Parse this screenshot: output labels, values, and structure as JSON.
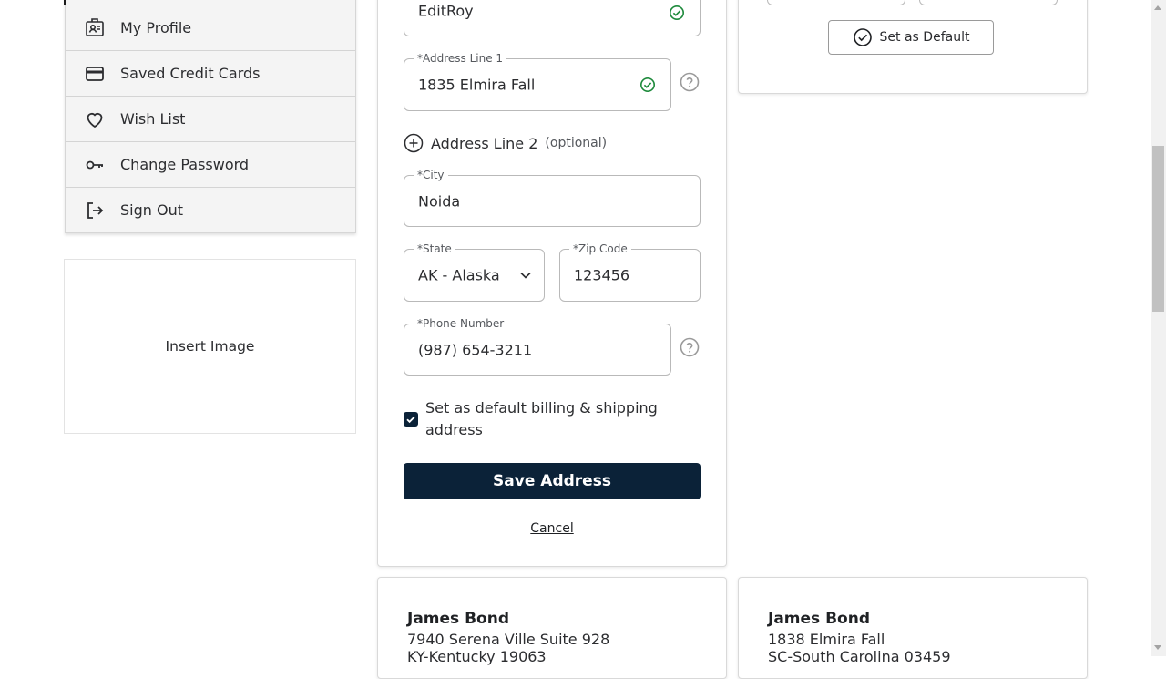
{
  "sidebar": {
    "items": [
      {
        "label": "My Profile",
        "icon": "profile-badge-icon"
      },
      {
        "label": "Saved Credit Cards",
        "icon": "credit-card-icon"
      },
      {
        "label": "Wish List",
        "icon": "heart-icon"
      },
      {
        "label": "Change Password",
        "icon": "key-icon"
      },
      {
        "label": "Sign Out",
        "icon": "sign-out-icon"
      }
    ],
    "insert_image": "Insert Image"
  },
  "form": {
    "name_value": "EditRoy",
    "address1_label": "*Address Line 1",
    "address1_value": "1835 Elmira Fall",
    "address2_label": "Address Line 2",
    "address2_optional": "(optional)",
    "city_label": "*City",
    "city_value": "Noida",
    "state_label": "*State",
    "state_value": "AK - Alaska",
    "zip_label": "*Zip Code",
    "zip_value": "123456",
    "phone_label": "*Phone Number",
    "phone_value": "(987) 654-3211",
    "default_checkbox_label": "Set as default billing & shipping address",
    "default_checked": true,
    "save_label": "Save Address",
    "cancel_label": "Cancel"
  },
  "right_card": {
    "set_default_label": "Set as Default"
  },
  "address_cards": [
    {
      "name": "James Bond",
      "line1": "7940 Serena Ville Suite 928",
      "line2": "KY-Kentucky 19063"
    },
    {
      "name": "James Bond",
      "line1": "1838 Elmira Fall",
      "line2": "SC-South Carolina 03459"
    }
  ],
  "colors": {
    "primary": "#0b2238",
    "valid": "#1e8a3c",
    "help": "#9a9a9a"
  }
}
